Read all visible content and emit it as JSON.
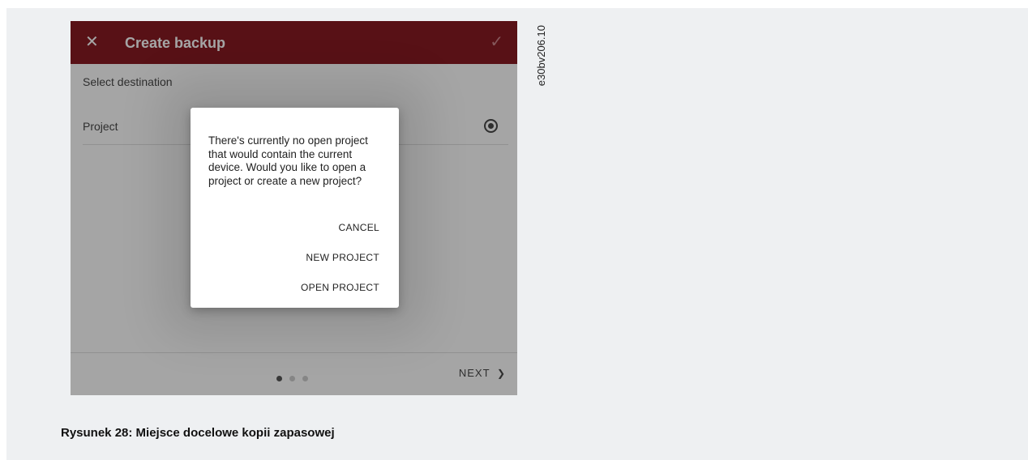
{
  "header": {
    "close_glyph": "✕",
    "title": "Create backup",
    "confirm_glyph": "✓"
  },
  "destination": {
    "section_label": "Select destination",
    "options": [
      {
        "label": "Project",
        "selected": true
      }
    ]
  },
  "footer": {
    "page_count": 3,
    "current_page": 1,
    "next_label": "NEXT",
    "next_glyph": "❯"
  },
  "dialog": {
    "message": "There's currently no open project that would contain the current device. Would you like to open a project or create a new project?",
    "cancel_label": "CANCEL",
    "new_project_label": "NEW PROJECT",
    "open_project_label": "OPEN PROJECT"
  },
  "figure": {
    "image_id_label": "e30bv206.10",
    "caption": "Rysunek 28:  Miejsce docelowe kopii zapasowej"
  },
  "colors": {
    "appbar": "#7b000a",
    "page_background": "#eef0f2"
  }
}
